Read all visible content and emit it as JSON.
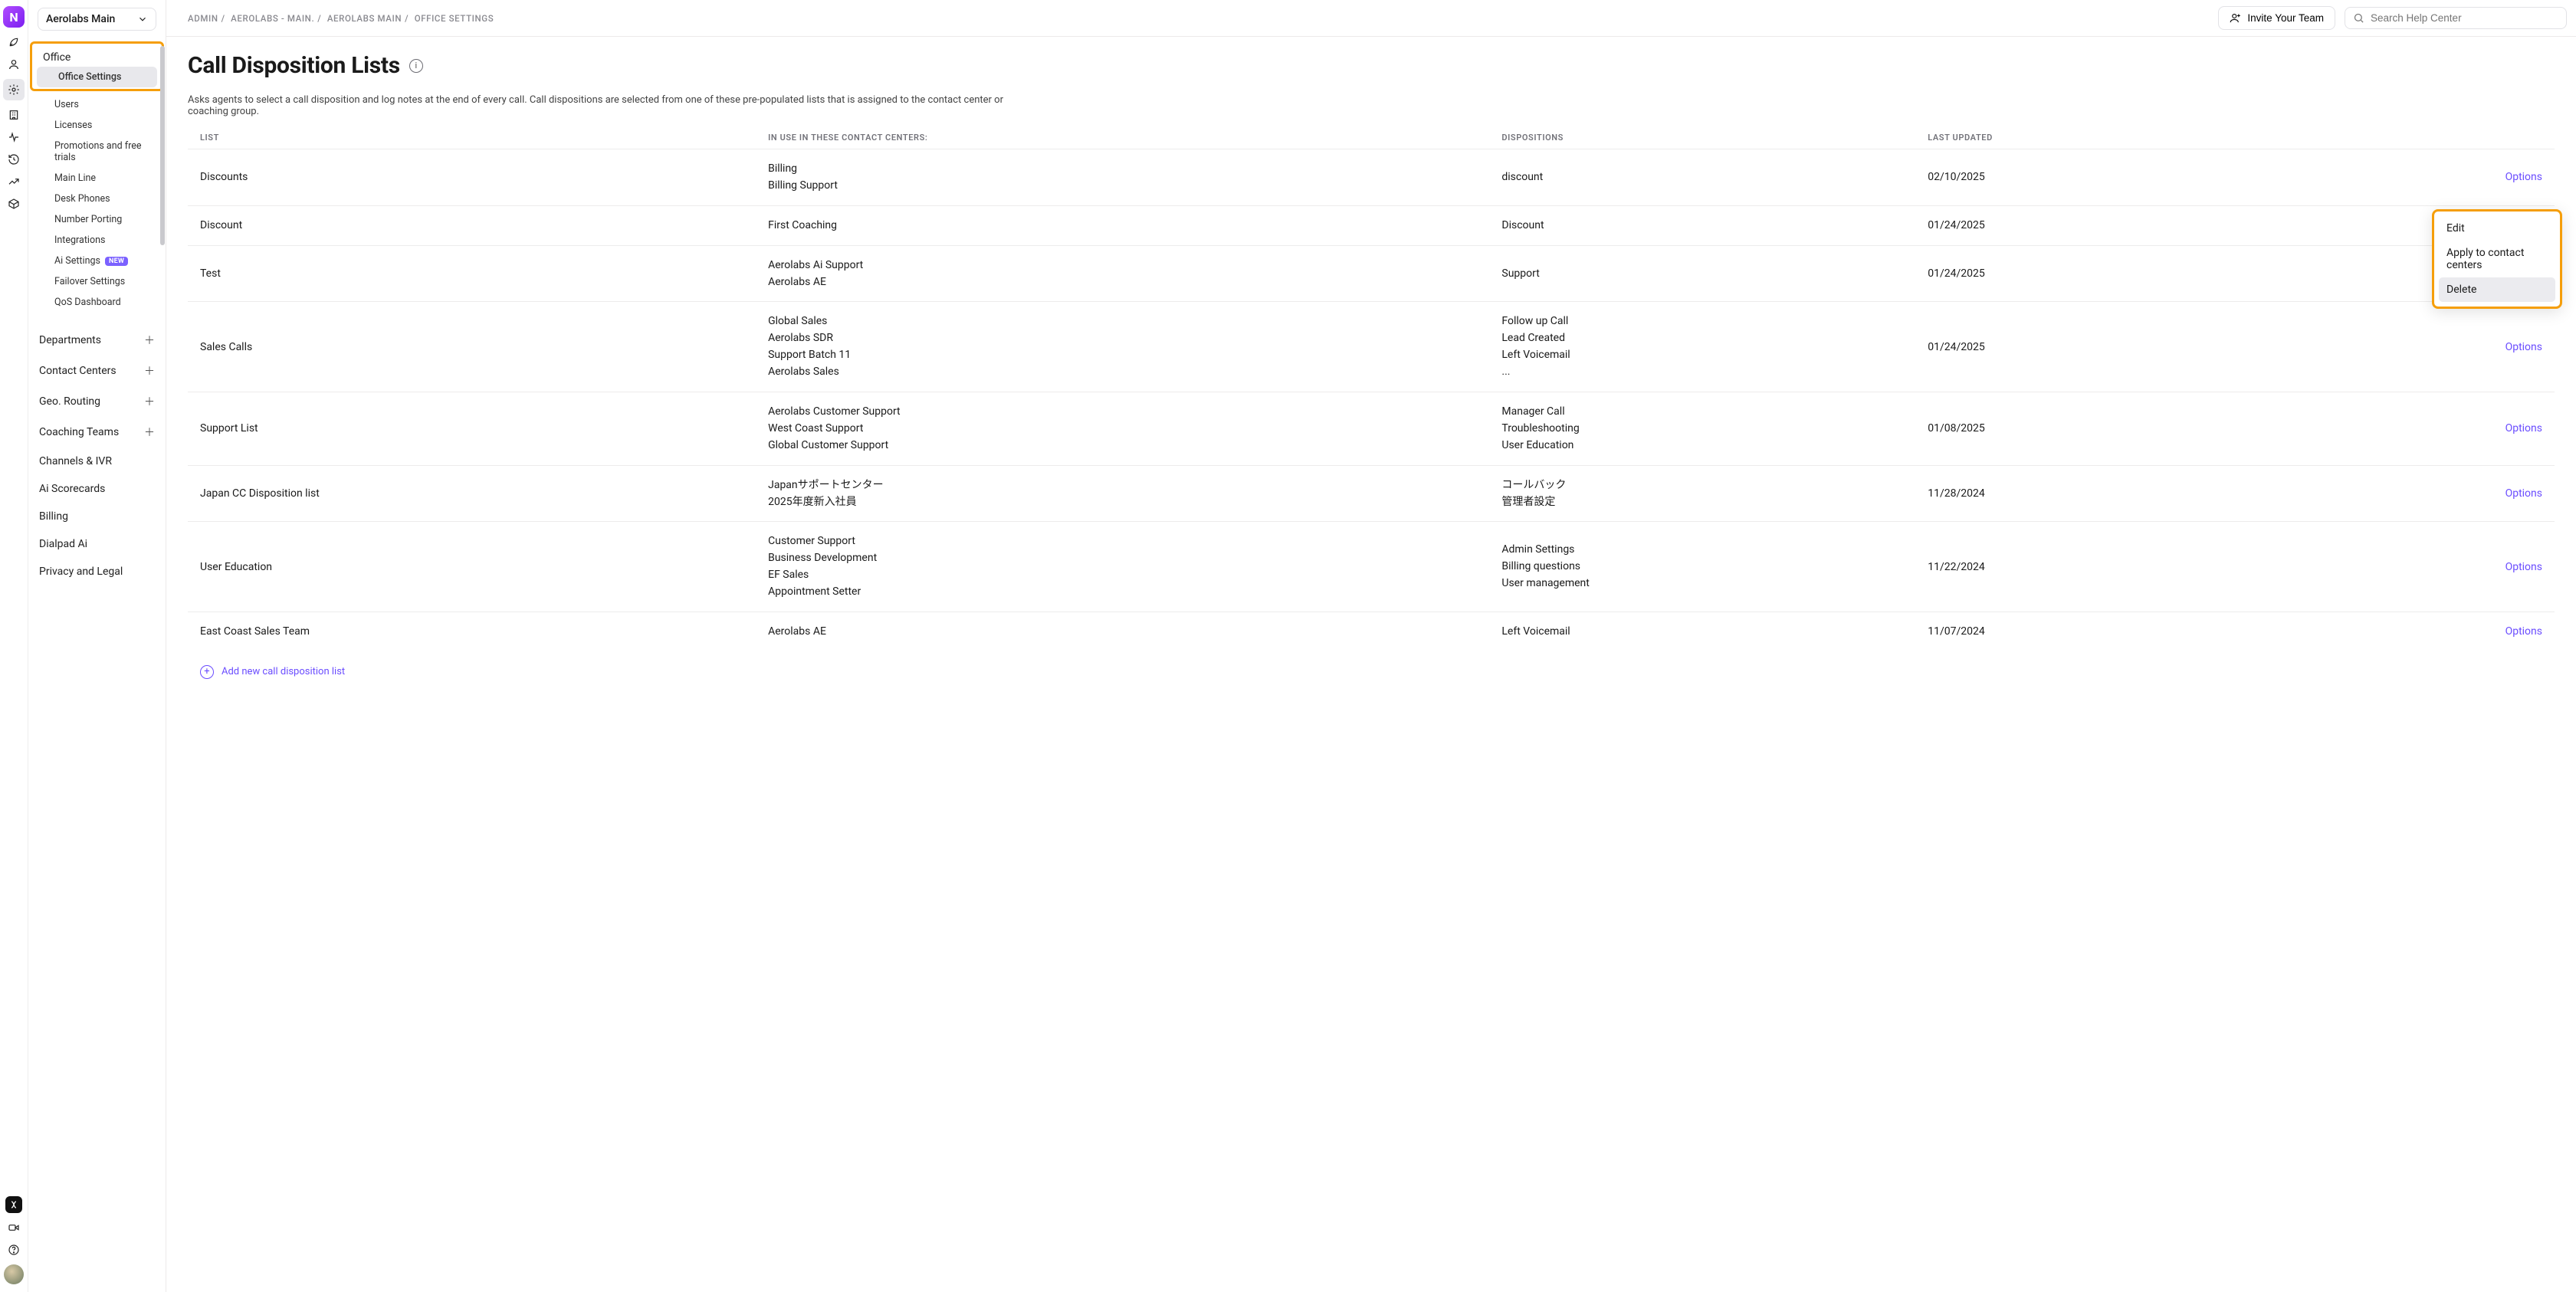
{
  "rail": {
    "logo_letter": "N"
  },
  "workspace": {
    "name": "Aerolabs Main"
  },
  "breadcrumbs": [
    "ADMIN",
    "AEROLABS - MAIN.",
    "AEROLABS MAIN",
    "OFFICE SETTINGS"
  ],
  "topbar": {
    "invite_label": "Invite Your Team",
    "search_placeholder": "Search Help Center"
  },
  "sidebar": {
    "office_label": "Office",
    "subnav": [
      "Office Settings",
      "Users",
      "Licenses",
      "Promotions and free trials",
      "Main Line",
      "Desk Phones",
      "Number Porting",
      "Integrations",
      "Ai Settings",
      "Failover Settings",
      "QoS Dashboard"
    ],
    "new_badge": "NEW",
    "sections": [
      "Departments",
      "Contact Centers",
      "Geo. Routing",
      "Coaching Teams",
      "Channels & IVR",
      "Ai Scorecards",
      "Billing",
      "Dialpad Ai",
      "Privacy and Legal"
    ]
  },
  "page": {
    "title": "Call Disposition Lists",
    "description": "Asks agents to select a call disposition and log notes at the end of every call. Call dispositions are selected from one of these pre-populated lists that is assigned to the contact center or coaching group.",
    "columns": {
      "list": "LIST",
      "in_use": "IN USE IN THESE CONTACT CENTERS:",
      "dispositions": "DISPOSITIONS",
      "last_updated": "LAST UPDATED"
    },
    "options_label": "Options",
    "add_label": "Add new call disposition list",
    "rows": [
      {
        "list": "Discounts",
        "cc": [
          "Billing",
          "Billing Support"
        ],
        "disp": [
          "discount"
        ],
        "date": "02/10/2025"
      },
      {
        "list": "Discount",
        "cc": [
          "First Coaching"
        ],
        "disp": [
          "Discount"
        ],
        "date": "01/24/2025"
      },
      {
        "list": "Test",
        "cc": [
          "Aerolabs Ai Support",
          "Aerolabs AE"
        ],
        "disp": [
          "Support"
        ],
        "date": "01/24/2025"
      },
      {
        "list": "Sales Calls",
        "cc": [
          "Global Sales",
          "Aerolabs SDR",
          "Support Batch 11",
          "Aerolabs Sales"
        ],
        "disp": [
          "Follow up Call",
          "Lead Created",
          "Left Voicemail",
          "..."
        ],
        "date": "01/24/2025"
      },
      {
        "list": "Support List",
        "cc": [
          "Aerolabs Customer Support",
          "West Coast Support",
          "Global Customer Support"
        ],
        "disp": [
          "Manager Call",
          "Troubleshooting",
          "User Education"
        ],
        "date": "01/08/2025"
      },
      {
        "list": "Japan CC Disposition list",
        "cc": [
          "Japanサポートセンター",
          "2025年度新入社員"
        ],
        "disp": [
          "コールバック",
          "管理者設定"
        ],
        "date": "11/28/2024"
      },
      {
        "list": "User Education",
        "cc": [
          "Customer Support",
          "Business Development",
          "EF Sales",
          "Appointment Setter"
        ],
        "disp": [
          "Admin Settings",
          "Billing questions",
          "User management"
        ],
        "date": "11/22/2024"
      },
      {
        "list": "East Coast Sales Team",
        "cc": [
          "Aerolabs AE"
        ],
        "disp": [
          "Left Voicemail"
        ],
        "date": "11/07/2024"
      }
    ]
  },
  "options_menu": {
    "edit": "Edit",
    "apply": "Apply to contact centers",
    "delete": "Delete"
  }
}
